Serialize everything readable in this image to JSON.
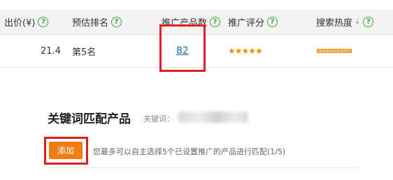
{
  "table": {
    "headers": [
      {
        "label": "出价(¥)",
        "help": "?"
      },
      {
        "label": "预估排名",
        "help": "?"
      },
      {
        "label": "推广产品数",
        "help": "?"
      },
      {
        "label": "推广评分",
        "help": "?"
      },
      {
        "label": "搜索热度",
        "sort_icon": "sort-down-arrow-icon",
        "sort_glyph": "⇣",
        "help": "?"
      }
    ],
    "row": {
      "bid": "21.4",
      "rank": "第5名",
      "product_count": "82",
      "rating_stars": "★★★★★",
      "rating_value": 5
    }
  },
  "keyword_section": {
    "title": "关键词匹配产品",
    "keyword_label": "关键词：",
    "add_button": "添加",
    "hint": "您最多可以自主选择5个已设置推广的产品进行匹配(1/5)"
  },
  "colors": {
    "highlight_border": "#e02020",
    "help_icon": "#3aa63a",
    "button_bg": "#f07c16",
    "link": "#1a6fb5",
    "stars": "#f08c00"
  }
}
